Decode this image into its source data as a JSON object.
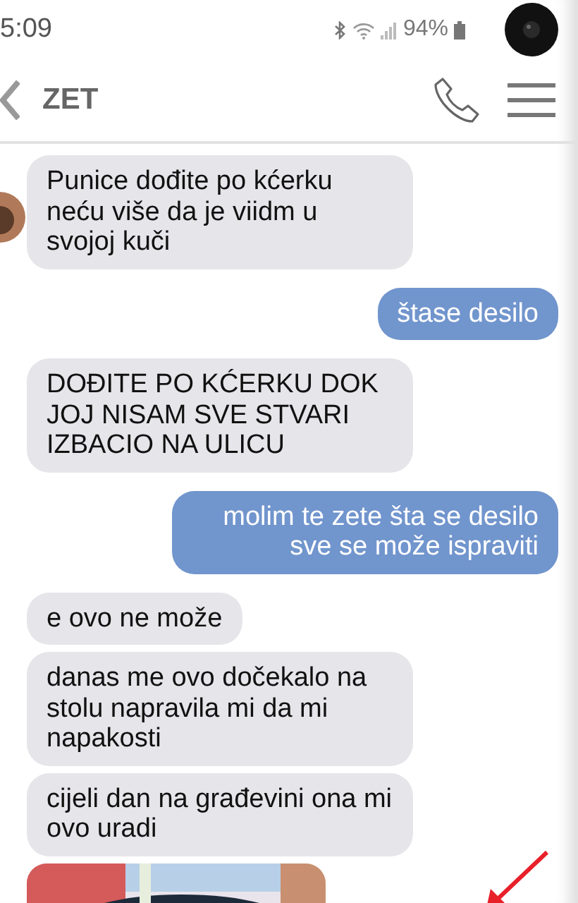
{
  "status_bar": {
    "time": "5:09",
    "battery": "94%"
  },
  "header": {
    "title": "ZET"
  },
  "messages": [
    {
      "kind": "incoming",
      "text": "Punice dođite po kćerku neću više da je viidm u svojoj kuči",
      "avatar": true
    },
    {
      "kind": "outgoing",
      "text": "štase desilo"
    },
    {
      "kind": "incoming",
      "text": "DOĐITE PO KĆERKU DOK JOJ NISAM SVE STVARI IZBACIO NA ULICU"
    },
    {
      "kind": "outgoing",
      "text": "molim te zete šta se desilo sve se može ispraviti"
    },
    {
      "kind": "incoming",
      "text": "e ovo ne može"
    },
    {
      "kind": "incoming",
      "text": "danas me ovo dočekalo na stolu napravila mi da mi napakosti"
    },
    {
      "kind": "incoming",
      "text": "cijeli dan na građevini ona mi ovo uradi"
    },
    {
      "kind": "picture"
    }
  ]
}
